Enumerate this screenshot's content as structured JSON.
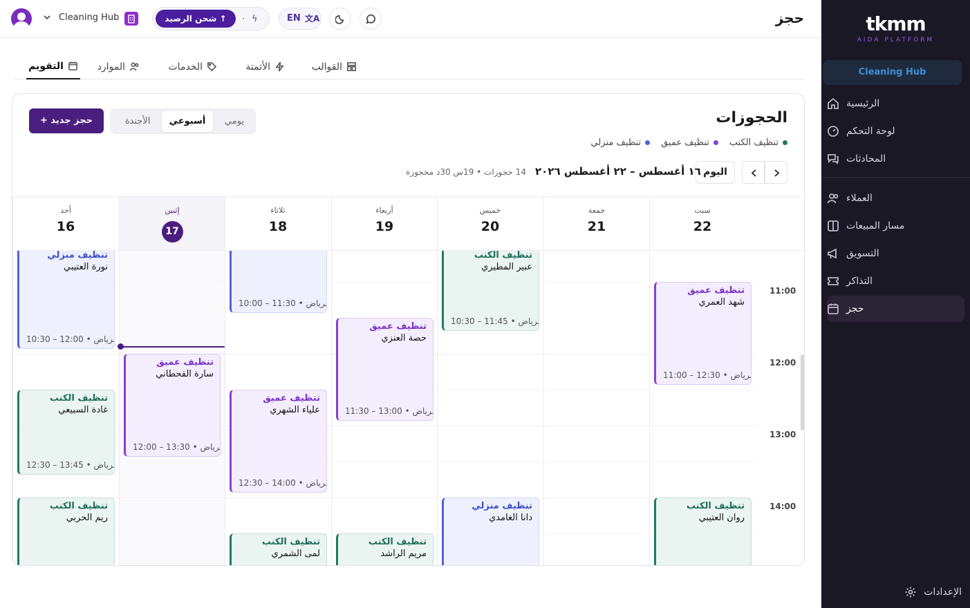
{
  "header": {
    "page_title": "حجز",
    "workspace_name": "Cleaning Hub",
    "recharge_label": "شحن الرصيد",
    "balance": "٠",
    "lang_label": "EN"
  },
  "sidebar": {
    "logo": "tkmm",
    "logo_sub": "AIDA PLATFORM",
    "workspace": "Cleaning Hub",
    "items": [
      {
        "label": "الرئيسية",
        "icon": "home-icon"
      },
      {
        "label": "لوحة التحكم",
        "icon": "gauge-icon"
      },
      {
        "label": "المحادثات",
        "icon": "chat-icon"
      },
      {
        "label": "العملاء",
        "icon": "users-icon"
      },
      {
        "label": "مسار المبيعات",
        "icon": "pipeline-icon"
      },
      {
        "label": "التسويق",
        "icon": "megaphone-icon"
      },
      {
        "label": "التذاكر",
        "icon": "ticket-icon"
      },
      {
        "label": "حجز",
        "icon": "calendar-icon"
      }
    ],
    "settings": "الإعدادات"
  },
  "tabs": [
    {
      "label": "التقويم",
      "icon": "calendar-icon",
      "active": true
    },
    {
      "label": "الموارد",
      "icon": "users-icon"
    },
    {
      "label": "الخدمات",
      "icon": "tag-icon"
    },
    {
      "label": "الأتمتة",
      "icon": "bolt-icon"
    },
    {
      "label": "القوالب",
      "icon": "template-icon"
    }
  ],
  "calendar": {
    "title": "الحجوزات",
    "legend": [
      {
        "label": "تنظيف منزلي",
        "color": "#5561d6"
      },
      {
        "label": "تنظيف عميق",
        "color": "#8a3fd4"
      },
      {
        "label": "تنظيف الكنب",
        "color": "#1f7a63"
      }
    ],
    "new_booking": "حجز جديد",
    "views": [
      "يومي",
      "أسبوعي",
      "الأجندة"
    ],
    "active_view": "أسبوعي",
    "today_label": "اليوم",
    "range": "١٦ أغسطس – ٢٢ أغسطس ٢٠٢٦",
    "range_meta": "14 حجوزات • 19س 30د محجوزة",
    "days": [
      {
        "name": "أحد",
        "date": "16"
      },
      {
        "name": "إثنين",
        "date": "17",
        "today": true
      },
      {
        "name": "ثلاثاء",
        "date": "18"
      },
      {
        "name": "أربعاء",
        "date": "19"
      },
      {
        "name": "خميس",
        "date": "20"
      },
      {
        "name": "جمعة",
        "date": "21"
      },
      {
        "name": "سبت",
        "date": "22"
      }
    ],
    "time_labels": [
      "11:00",
      "12:00",
      "13:00",
      "14:00"
    ],
    "events": [
      {
        "service": "تنظيف منزلي",
        "customer": "نورة العتيبي",
        "time": "10:30 – 12:00 • الرياض…",
        "type": "home",
        "day": 0
      },
      {
        "service": "تنظيف الكنب",
        "customer": "غادة السبيعي",
        "time": "12:30 – 13:45 • الرياض…",
        "type": "book",
        "day": 0
      },
      {
        "service": "تنظيف الكنب",
        "customer": "ريم الحربي",
        "time": "",
        "type": "book",
        "day": 0
      },
      {
        "service": "تنظيف عميق",
        "customer": "سارة القحطاني",
        "time": "12:00 – 13:30 • الرياض…",
        "type": "deep",
        "day": 1
      },
      {
        "service": "",
        "customer": "",
        "time": "10:00 – 11:30 • الرياض…",
        "type": "home",
        "day": 2
      },
      {
        "service": "تنظيف عميق",
        "customer": "علياء الشهري",
        "time": "12:30 – 14:00 • الرياض…",
        "type": "deep",
        "day": 2
      },
      {
        "service": "تنظيف الكنب",
        "customer": "لمى الشمري",
        "time": "",
        "type": "book",
        "day": 2
      },
      {
        "service": "تنظيف عميق",
        "customer": "حصة العنزي",
        "time": "11:30 – 13:00 • الرياض…",
        "type": "deep",
        "day": 3
      },
      {
        "service": "تنظيف الكنب",
        "customer": "مريم الراشد",
        "time": "",
        "type": "book",
        "day": 3
      },
      {
        "service": "تنظيف الكنب",
        "customer": "عبير المطيري",
        "time": "10:30 – 11:45 • الرياض…",
        "type": "book",
        "day": 4
      },
      {
        "service": "تنظيف منزلي",
        "customer": "دانا الغامدي",
        "time": "",
        "type": "home",
        "day": 4
      },
      {
        "service": "تنظيف عميق",
        "customer": "شهد العمري",
        "time": "11:00 – 12:30 • الرياض…",
        "type": "deep",
        "day": 6
      },
      {
        "service": "تنظيف الكنب",
        "customer": "روان العتيبي",
        "time": "",
        "type": "book",
        "day": 6
      }
    ]
  }
}
